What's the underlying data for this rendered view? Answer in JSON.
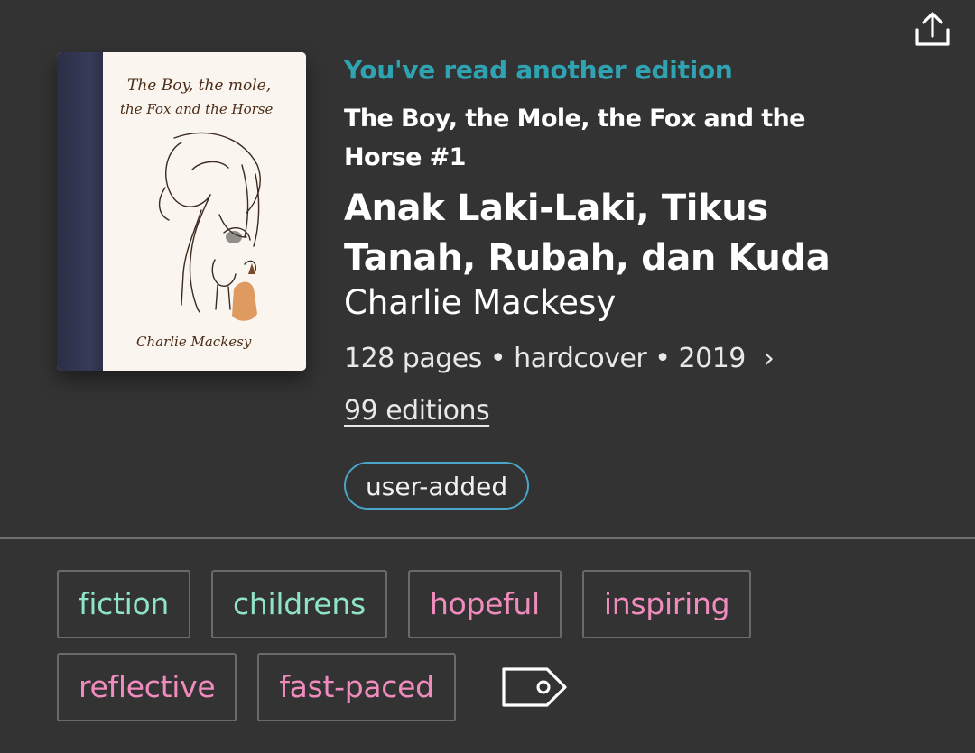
{
  "header": {
    "share_icon": "share-icon"
  },
  "book": {
    "cover": {
      "title_line1": "The Boy, the mole,",
      "title_line2": "the Fox and the Horse",
      "author_line": "Charlie Mackesy",
      "spine_color": "#2f334d",
      "paper_color": "#faf5ee",
      "ink_color": "#4a2c18"
    },
    "read_status": "You've read another edition",
    "series": "The Boy, the Mole, the Fox and the Horse #1",
    "title": "Anak Laki-Laki, Tikus Tanah, Rubah, dan Kuda",
    "author": "Charlie Mackesy",
    "meta": "128 pages • hardcover • 2019",
    "meta_chevron": "›",
    "editions": "99 editions",
    "badge": "user-added"
  },
  "tags": {
    "rows": [
      [
        {
          "label": "fiction",
          "kind": "genre"
        },
        {
          "label": "childrens",
          "kind": "genre"
        },
        {
          "label": "hopeful",
          "kind": "mood"
        },
        {
          "label": "inspiring",
          "kind": "mood"
        }
      ],
      [
        {
          "label": "reflective",
          "kind": "mood"
        },
        {
          "label": "fast-paced",
          "kind": "mood"
        }
      ]
    ],
    "add_icon": "tag-icon"
  },
  "colors": {
    "background": "#333333",
    "accent_teal": "#2fa3b2",
    "badge_border": "#4aa6c8",
    "genre_tag": "#8fe3c6",
    "mood_tag": "#f08bbd",
    "tag_border": "#6a6a6a",
    "divider": "#6f6f6f"
  }
}
